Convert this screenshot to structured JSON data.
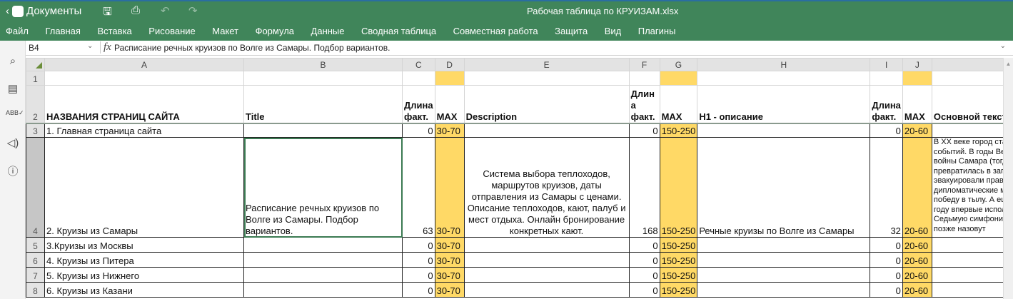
{
  "app": {
    "back_label": "Документы",
    "doc_title": "Рабочая таблица по КРУИЗАМ.xlsx",
    "brand_color": "#40855a",
    "highlight_color": "#ffd966"
  },
  "toolbar_icons": [
    "save-icon",
    "print-icon",
    "undo-icon",
    "redo-icon"
  ],
  "menu": [
    "Файл",
    "Главная",
    "Вставка",
    "Рисование",
    "Макет",
    "Формула",
    "Данные",
    "Сводная таблица",
    "Совместная работа",
    "Защита",
    "Вид",
    "Плагины"
  ],
  "formula_bar": {
    "cell_ref": "B4",
    "fx": "fx",
    "value": "Расписание речных круизов по Волге из Самары. Подбор вариантов."
  },
  "sidebar_icons": [
    "search-icon",
    "comment-icon",
    "spellcheck-icon",
    "feedback-icon",
    "info-icon"
  ],
  "columns": [
    "A",
    "B",
    "C",
    "D",
    "E",
    "F",
    "G",
    "H",
    "I",
    "J",
    ""
  ],
  "selected_column": "B",
  "rows": [
    {
      "n": "1",
      "cells": [
        "",
        "",
        "",
        "",
        "",
        "",
        "",
        "",
        "",
        "",
        ""
      ]
    },
    {
      "n": "2",
      "cells": [
        "НАЗВАНИЯ СТРАНИЦ САЙТА",
        "Title",
        "Длина факт.",
        "MAX",
        "Description",
        "Длин а факт.",
        "MAX",
        "H1 - описание",
        "Длина факт.",
        "MAX",
        "Основной текст"
      ]
    },
    {
      "n": "3",
      "cells": [
        "1. Главная страница сайта",
        "",
        "0",
        "30-70",
        "",
        "0",
        "150-250",
        "",
        "0",
        "20-60",
        ""
      ]
    },
    {
      "n": "4",
      "cells": [
        "2. Круизы из Самары",
        "Расписание речных круизов по Волге из Самары. Подбор вариантов.",
        "63",
        "30-70",
        "Система выбора теплоходов, маршрутов круизов, даты отправления из Самары с ценами. Описание теплоходов, кают, палуб и мест отдыха. Онлайн бронирование конкретных кают.",
        "168",
        "150-250",
        "Речные круизы по Волге из Самары",
        "32",
        "20-60",
        "В XX веке город ста\nсобытий. В годы Вел\nвойны Самара (тогд\nпревратилась в зап\nэвакуировали прави\nдипломатические ми\nпобеду в тылу. А ещ\nгоду впервые испол\nСедьмую симфонию\nпозже назовут"
      ]
    },
    {
      "n": "5",
      "cells": [
        "3.Круизы из Москвы",
        "",
        "0",
        "30-70",
        "",
        "0",
        "150-250",
        "",
        "0",
        "20-60",
        ""
      ]
    },
    {
      "n": "6",
      "cells": [
        "4. Круизы из Питера",
        "",
        "0",
        "30-70",
        "",
        "0",
        "150-250",
        "",
        "0",
        "20-60",
        ""
      ]
    },
    {
      "n": "7",
      "cells": [
        "5. Круизы из Нижнего",
        "",
        "0",
        "30-70",
        "",
        "0",
        "150-250",
        "",
        "0",
        "20-60",
        ""
      ]
    },
    {
      "n": "8",
      "cells": [
        "6. Круизы из Казани",
        "",
        "0",
        "30-70",
        "",
        "0",
        "150-250",
        "",
        "0",
        "20-60",
        ""
      ]
    }
  ]
}
